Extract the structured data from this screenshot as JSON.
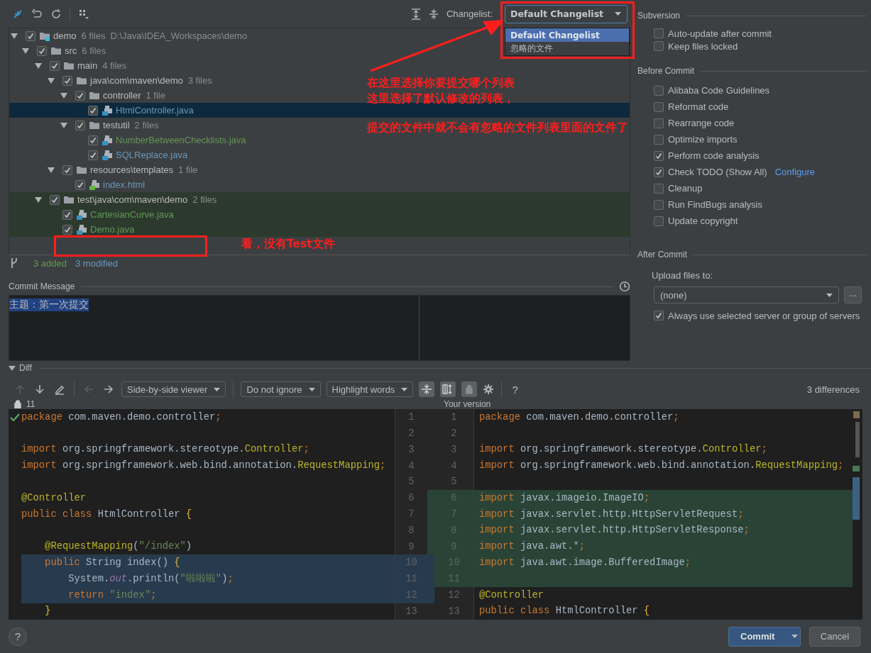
{
  "changes": {
    "changelist_label": "Changelist:",
    "changelist": "Default Changelist",
    "changelist_menu": [
      {
        "label": "Default Changelist",
        "selected": true
      },
      {
        "label": "忽略的文件",
        "selected": false
      }
    ],
    "tree": [
      {
        "name": "demo",
        "count": "6 files",
        "path": "D:\\Java\\IDEA_Workspaces\\demo",
        "kind": "module",
        "checked": true,
        "expanded": true,
        "selected": false,
        "highlighted": false,
        "children": [
          {
            "name": "src",
            "count": "6 files",
            "kind": "folder",
            "checked": true,
            "expanded": true,
            "selected": false,
            "highlighted": false,
            "children": [
              {
                "name": "main",
                "count": "4 files",
                "kind": "folder",
                "checked": true,
                "expanded": true,
                "selected": false,
                "highlighted": false,
                "children": [
                  {
                    "name": "java\\com\\maven\\demo",
                    "count": "3 files",
                    "kind": "folder",
                    "checked": true,
                    "expanded": true,
                    "selected": false,
                    "highlighted": false,
                    "children": [
                      {
                        "name": "controller",
                        "count": "1 file",
                        "kind": "folder",
                        "checked": true,
                        "expanded": true,
                        "selected": false,
                        "highlighted": false,
                        "children": [
                          {
                            "name": "HtmlController.java",
                            "kind": "java",
                            "color": "#6897bb",
                            "checked": true,
                            "selected": true,
                            "highlighted": false
                          }
                        ]
                      },
                      {
                        "name": "testutil",
                        "count": "2 files",
                        "kind": "folder",
                        "checked": true,
                        "expanded": true,
                        "selected": false,
                        "highlighted": false,
                        "children": [
                          {
                            "name": "NumberBetweenChecklists.java",
                            "kind": "java",
                            "color": "#629755",
                            "checked": true,
                            "selected": false,
                            "highlighted": false
                          },
                          {
                            "name": "SQLReplace.java",
                            "kind": "java",
                            "color": "#6897bb",
                            "checked": true,
                            "selected": false,
                            "highlighted": false
                          }
                        ]
                      }
                    ]
                  },
                  {
                    "name": "resources\\templates",
                    "count": "1 file",
                    "kind": "folder",
                    "checked": true,
                    "expanded": true,
                    "selected": false,
                    "highlighted": false,
                    "children": [
                      {
                        "name": "index.html",
                        "kind": "html",
                        "color": "#6897bb",
                        "checked": true,
                        "selected": false,
                        "highlighted": false
                      }
                    ]
                  }
                ]
              },
              {
                "name": "test\\java\\com\\maven\\demo",
                "count": "2 files",
                "kind": "folder",
                "checked": true,
                "expanded": true,
                "selected": false,
                "highlighted": true,
                "children": [
                  {
                    "name": "CartesianCurve.java",
                    "kind": "java",
                    "color": "#629755",
                    "checked": true,
                    "selected": false,
                    "highlighted": true
                  },
                  {
                    "name": "Demo.java",
                    "kind": "java",
                    "color": "#629755",
                    "checked": true,
                    "selected": false,
                    "highlighted": true
                  }
                ]
              }
            ]
          }
        ]
      }
    ],
    "summary": [
      {
        "text": "3 added",
        "color": "#629755"
      },
      {
        "text": "3 modified",
        "color": "#6897bb"
      }
    ]
  },
  "commit_message": {
    "label": "Commit Message",
    "text": "主题：第一次提交",
    "text_selected": true
  },
  "options": [
    {
      "title": "Subversion",
      "options": [
        {
          "label": "Auto-update after commit",
          "checked": false
        },
        {
          "label": "Keep files locked",
          "checked": false
        }
      ]
    },
    {
      "title": "Before Commit",
      "options": [
        {
          "label": "Alibaba Code Guidelines",
          "checked": false
        },
        {
          "label": "Reformat code",
          "checked": false
        },
        {
          "label": "Rearrange code",
          "checked": false
        },
        {
          "label": "Optimize imports",
          "checked": false
        },
        {
          "label": "Perform code analysis",
          "checked": true
        },
        {
          "label": "Check TODO (Show All)",
          "link": "Configure",
          "checked": true
        },
        {
          "label": "Cleanup",
          "checked": false
        },
        {
          "label": "Run FindBugs analysis",
          "checked": false
        },
        {
          "label": "Update copyright",
          "checked": false
        }
      ]
    },
    {
      "title": "After Commit",
      "upload_label": "Upload files to:",
      "upload_value": "(none)",
      "browse_button": "...",
      "options": [
        {
          "label": "Always use selected server or group of servers",
          "checked": true
        }
      ]
    }
  ],
  "diff": {
    "title": "Diff",
    "expanded": true,
    "nav_buttons": [
      {
        "kind": "up",
        "disabled": true
      },
      {
        "kind": "down",
        "disabled": false
      },
      {
        "kind": "edit",
        "disabled": false
      },
      {
        "kind": "back",
        "disabled": true
      },
      {
        "kind": "forward",
        "disabled": false
      }
    ],
    "dropdowns": [
      "Side-by-side viewer",
      "Do not ignore",
      "Highlight words"
    ],
    "toggles": [
      {
        "kind": "collapse",
        "on": true
      },
      {
        "kind": "sync",
        "on": true
      },
      {
        "kind": "lock",
        "on": true
      }
    ],
    "help": "?",
    "differences": "3 differences",
    "left_label": "11",
    "right_label": "Your version",
    "left_lines": [
      {
        "number": "1",
        "changed": false,
        "segments": [
          {
            "text": "package",
            "kind": "keyword"
          },
          {
            "text": " com.maven.demo.controller",
            "kind": "plain"
          },
          {
            "text": ";",
            "kind": "keyword"
          }
        ]
      },
      {
        "number": "2",
        "changed": false
      },
      {
        "number": "3",
        "changed": false,
        "segments": [
          {
            "text": "import",
            "kind": "keyword"
          },
          {
            "text": " org.springframework.stereotype.",
            "kind": "plain"
          },
          {
            "text": "Controller",
            "kind": "type"
          },
          {
            "text": ";",
            "kind": "keyword"
          }
        ]
      },
      {
        "number": "4",
        "changed": false,
        "segments": [
          {
            "text": "import",
            "kind": "keyword"
          },
          {
            "text": " org.springframework.web.bind.annotation.",
            "kind": "plain"
          },
          {
            "text": "RequestMapping",
            "kind": "type"
          },
          {
            "text": ";",
            "kind": "keyword"
          }
        ]
      },
      {
        "number": "5",
        "changed": false
      },
      {
        "number": "6",
        "changed": false,
        "segments": [
          {
            "text": "@Controller",
            "kind": "annotation"
          }
        ]
      },
      {
        "number": "7",
        "changed": false,
        "segments": [
          {
            "text": "public class",
            "kind": "keyword"
          },
          {
            "text": " HtmlController ",
            "kind": "plain"
          },
          {
            "text": "{",
            "kind": "brace"
          }
        ]
      },
      {
        "number": "8",
        "changed": false
      },
      {
        "number": "9",
        "changed": false,
        "segments": [
          {
            "text": "    @RequestMapping",
            "kind": "annotation"
          },
          {
            "text": "(",
            "kind": "plain"
          },
          {
            "text": "\"/index\"",
            "kind": "string"
          },
          {
            "text": ")",
            "kind": "plain"
          }
        ]
      },
      {
        "number": "10",
        "changed": true,
        "segments": [
          {
            "text": "    public",
            "kind": "keyword"
          },
          {
            "text": " String index() ",
            "kind": "plain"
          },
          {
            "text": "{",
            "kind": "brace"
          }
        ]
      },
      {
        "number": "11",
        "changed": true,
        "segments": [
          {
            "text": "        System.",
            "kind": "plain"
          },
          {
            "text": "out",
            "kind": "field"
          },
          {
            "text": ".println(",
            "kind": "plain"
          },
          {
            "text": "\"啦啦啦\"",
            "kind": "string"
          },
          {
            "text": ")",
            "kind": "plain"
          },
          {
            "text": ";",
            "kind": "keyword"
          }
        ]
      },
      {
        "number": "12",
        "changed": true,
        "segments": [
          {
            "text": "        return",
            "kind": "keyword"
          },
          {
            "text": " \"index\"",
            "kind": "string"
          },
          {
            "text": ";",
            "kind": "keyword"
          }
        ]
      },
      {
        "number": "13",
        "changed": false,
        "segments": [
          {
            "text": "    }",
            "kind": "brace"
          }
        ]
      }
    ],
    "right_lines": [
      {
        "number": "1",
        "changed": false,
        "segments": [
          {
            "text": "package",
            "kind": "keyword"
          },
          {
            "text": " com.maven.demo.controller",
            "kind": "plain"
          },
          {
            "text": ";",
            "kind": "keyword"
          }
        ]
      },
      {
        "number": "2",
        "changed": false
      },
      {
        "number": "3",
        "changed": false,
        "segments": [
          {
            "text": "import",
            "kind": "keyword"
          },
          {
            "text": " org.springframework.stereotype.",
            "kind": "plain"
          },
          {
            "text": "Controller",
            "kind": "type"
          },
          {
            "text": ";",
            "kind": "keyword"
          }
        ]
      },
      {
        "number": "4",
        "changed": false,
        "segments": [
          {
            "text": "import",
            "kind": "keyword"
          },
          {
            "text": " org.springframework.web.bind.annotation.",
            "kind": "plain"
          },
          {
            "text": "RequestMapping",
            "kind": "type"
          },
          {
            "text": ";",
            "kind": "keyword"
          }
        ]
      },
      {
        "number": "5",
        "changed": false
      },
      {
        "number": "6",
        "changed": true,
        "segments": [
          {
            "text": "import",
            "kind": "keyword"
          },
          {
            "text": " javax.imageio.ImageIO",
            "kind": "plain"
          },
          {
            "text": ";",
            "kind": "keyword"
          }
        ]
      },
      {
        "number": "7",
        "changed": true,
        "segments": [
          {
            "text": "import",
            "kind": "keyword"
          },
          {
            "text": " javax.servlet.http.HttpServletRequest",
            "kind": "plain"
          },
          {
            "text": ";",
            "kind": "keyword"
          }
        ]
      },
      {
        "number": "8",
        "changed": true,
        "segments": [
          {
            "text": "import",
            "kind": "keyword"
          },
          {
            "text": " javax.servlet.http.HttpServletResponse",
            "kind": "plain"
          },
          {
            "text": ";",
            "kind": "keyword"
          }
        ]
      },
      {
        "number": "9",
        "changed": true,
        "segments": [
          {
            "text": "import",
            "kind": "keyword"
          },
          {
            "text": " java.awt.*",
            "kind": "plain"
          },
          {
            "text": ";",
            "kind": "keyword"
          }
        ]
      },
      {
        "number": "10",
        "changed": true,
        "segments": [
          {
            "text": "import",
            "kind": "keyword"
          },
          {
            "text": " java.awt.image.BufferedImage",
            "kind": "plain"
          },
          {
            "text": ";",
            "kind": "keyword"
          }
        ]
      },
      {
        "number": "11",
        "changed": true
      },
      {
        "number": "12",
        "changed": false,
        "segments": [
          {
            "text": "@Controller",
            "kind": "annotation"
          }
        ]
      },
      {
        "number": "13",
        "changed": false,
        "segments": [
          {
            "text": "public class",
            "kind": "keyword"
          },
          {
            "text": " HtmlController ",
            "kind": "plain"
          },
          {
            "text": "{",
            "kind": "brace"
          }
        ]
      }
    ]
  },
  "footer": {
    "help": "?",
    "buttons": [
      {
        "label": "Commit",
        "kind": "primary"
      },
      {
        "label": "Cancel",
        "kind": "normal"
      }
    ]
  },
  "annotations": [
    "在这里选择你要提交哪个列表",
    "这里选择了默认修改的列表，",
    "提交的文件中就不会有忽略的文件列表里面的文件了",
    "看，没有Test文件"
  ]
}
